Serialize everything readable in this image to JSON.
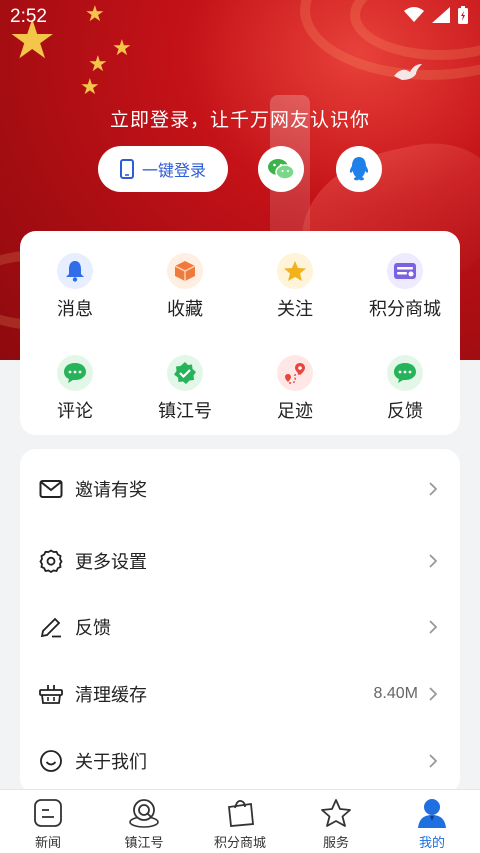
{
  "status_bar": {
    "time": "2:52"
  },
  "login": {
    "prompt": "立即登录，让千万网友认识你",
    "one_click_label": "一键登录"
  },
  "grid": [
    {
      "label": "消息",
      "icon": "bell-icon",
      "color": "#2e6ee8"
    },
    {
      "label": "收藏",
      "icon": "box-icon",
      "color": "#f07a3c"
    },
    {
      "label": "关注",
      "icon": "star-icon",
      "color": "#f3b21c"
    },
    {
      "label": "积分商城",
      "icon": "wallet-icon",
      "color": "#7a62e0"
    },
    {
      "label": "评论",
      "icon": "comment-icon",
      "color": "#27b35a"
    },
    {
      "label": "镇江号",
      "icon": "verified-badge-icon",
      "color": "#27b35a"
    },
    {
      "label": "足迹",
      "icon": "footprint-icon",
      "color": "#e8463d"
    },
    {
      "label": "反馈",
      "icon": "feedback-icon",
      "color": "#27b35a"
    }
  ],
  "menu": [
    {
      "label": "邀请有奖",
      "icon": "mail-icon",
      "value": ""
    },
    {
      "label": "更多设置",
      "icon": "gear-icon",
      "value": ""
    },
    {
      "label": "反馈",
      "icon": "pencil-icon",
      "value": ""
    },
    {
      "label": "清理缓存",
      "icon": "basket-icon",
      "value": "8.40M"
    },
    {
      "label": "关于我们",
      "icon": "smile-icon",
      "value": ""
    }
  ],
  "bottom_nav": [
    {
      "label": "新闻",
      "icon": "news-icon"
    },
    {
      "label": "镇江号",
      "icon": "location-q-icon"
    },
    {
      "label": "积分商城",
      "icon": "shopping-bag-icon"
    },
    {
      "label": "服务",
      "icon": "star-outline-icon"
    },
    {
      "label": "我的",
      "icon": "user-icon",
      "active": true
    }
  ],
  "colors": {
    "accent": "#1f6fe0",
    "hero_red": "#c41218"
  }
}
